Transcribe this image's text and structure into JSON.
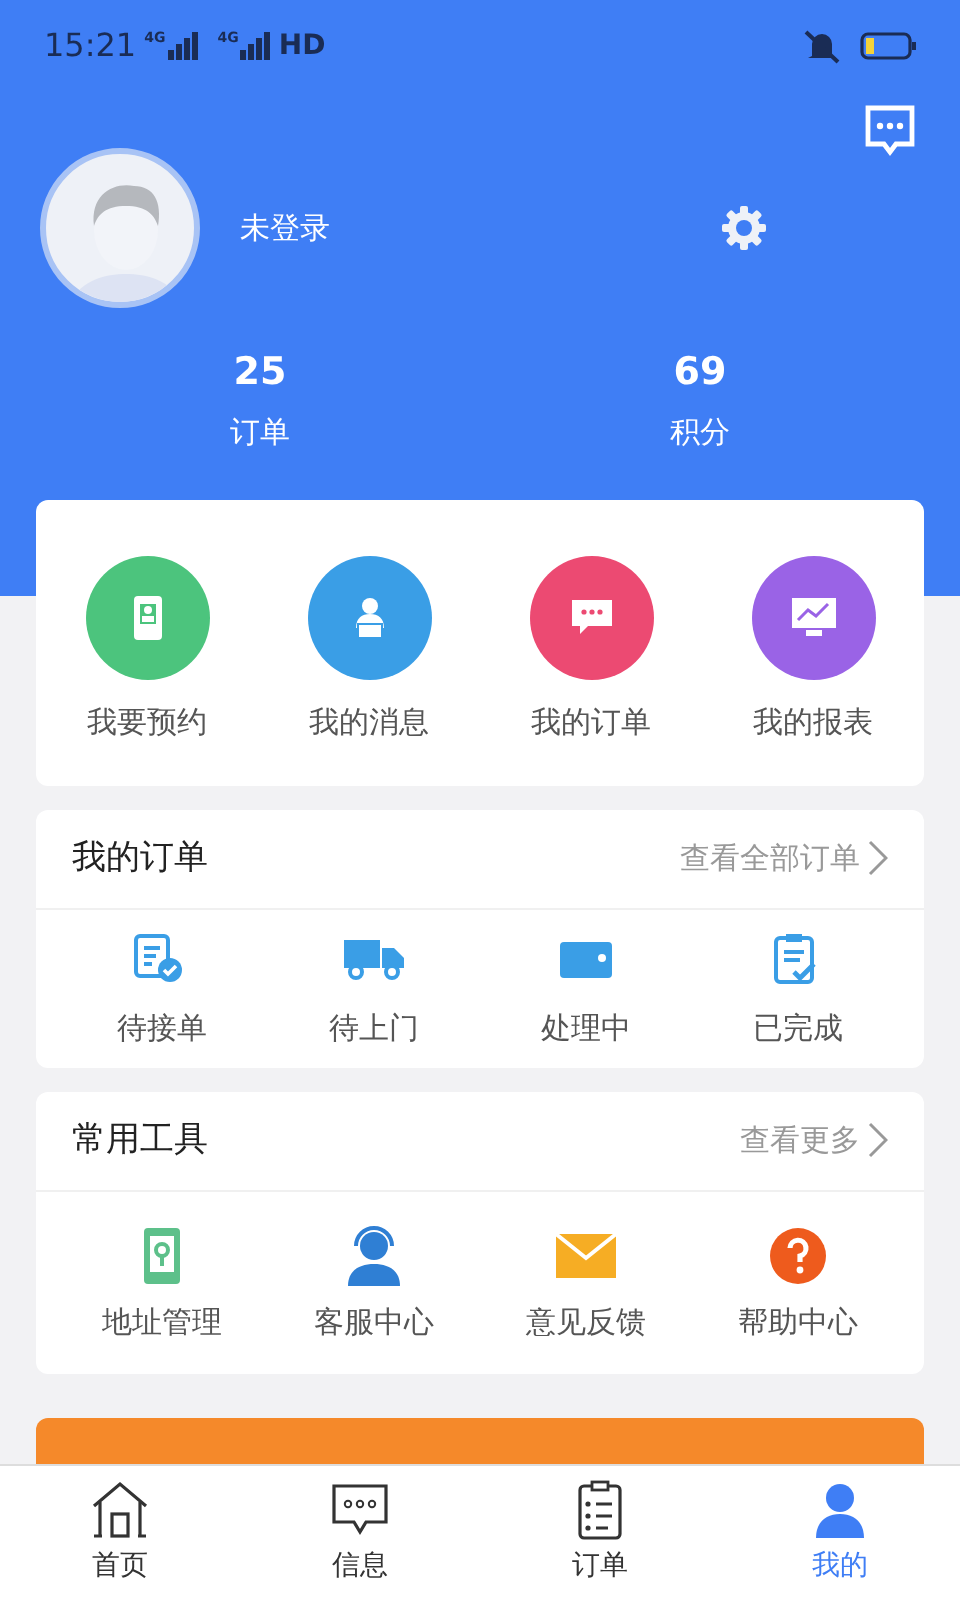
{
  "status_bar": {
    "time": "15:21",
    "signal_1": "4G",
    "signal_2": "4G",
    "hd": "HD"
  },
  "profile": {
    "username": "未登录",
    "stats": [
      {
        "value": "25",
        "label": "订单"
      },
      {
        "value": "69",
        "label": "积分"
      }
    ]
  },
  "shortcuts": [
    {
      "label": "我要预约",
      "color": "#4cc47d"
    },
    {
      "label": "我的消息",
      "color": "#3a9ee6"
    },
    {
      "label": "我的订单",
      "color": "#ec4a72"
    },
    {
      "label": "我的报表",
      "color": "#9a63e6"
    }
  ],
  "orders": {
    "title": "我的订单",
    "link": "查看全部订单",
    "items": [
      {
        "label": "待接单"
      },
      {
        "label": "待上门"
      },
      {
        "label": "处理中"
      },
      {
        "label": "已完成"
      }
    ]
  },
  "tools": {
    "title": "常用工具",
    "link": "查看更多",
    "items": [
      {
        "label": "地址管理"
      },
      {
        "label": "客服中心"
      },
      {
        "label": "意见反馈"
      },
      {
        "label": "帮助中心"
      }
    ]
  },
  "login_button": {
    "kind": "button"
  },
  "tab_bar": [
    {
      "label": "首页",
      "selected": false
    },
    {
      "label": "信息",
      "selected": false
    },
    {
      "label": "订单",
      "selected": false
    },
    {
      "label": "我的",
      "selected": true
    }
  ]
}
